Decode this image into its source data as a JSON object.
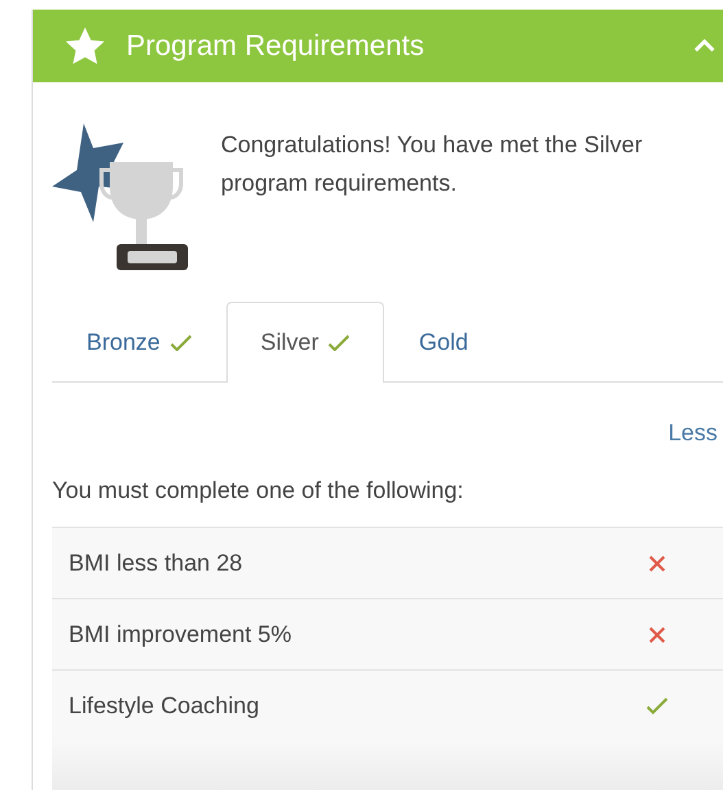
{
  "panel": {
    "title": "Program Requirements",
    "expanded": true
  },
  "message": "Congratulations! You have met the Silver program requirements.",
  "tabs": [
    {
      "label": "Bronze",
      "met": true,
      "selected": false
    },
    {
      "label": "Silver",
      "met": true,
      "selected": true
    },
    {
      "label": "Gold",
      "met": false,
      "selected": false
    }
  ],
  "toggle_link": "Less",
  "instruction": "You must complete one of the following:",
  "requirements": [
    {
      "label": "BMI less than 28",
      "met": false
    },
    {
      "label": "BMI improvement 5%",
      "met": false
    },
    {
      "label": "Lifestyle Coaching",
      "met": true
    }
  ]
}
